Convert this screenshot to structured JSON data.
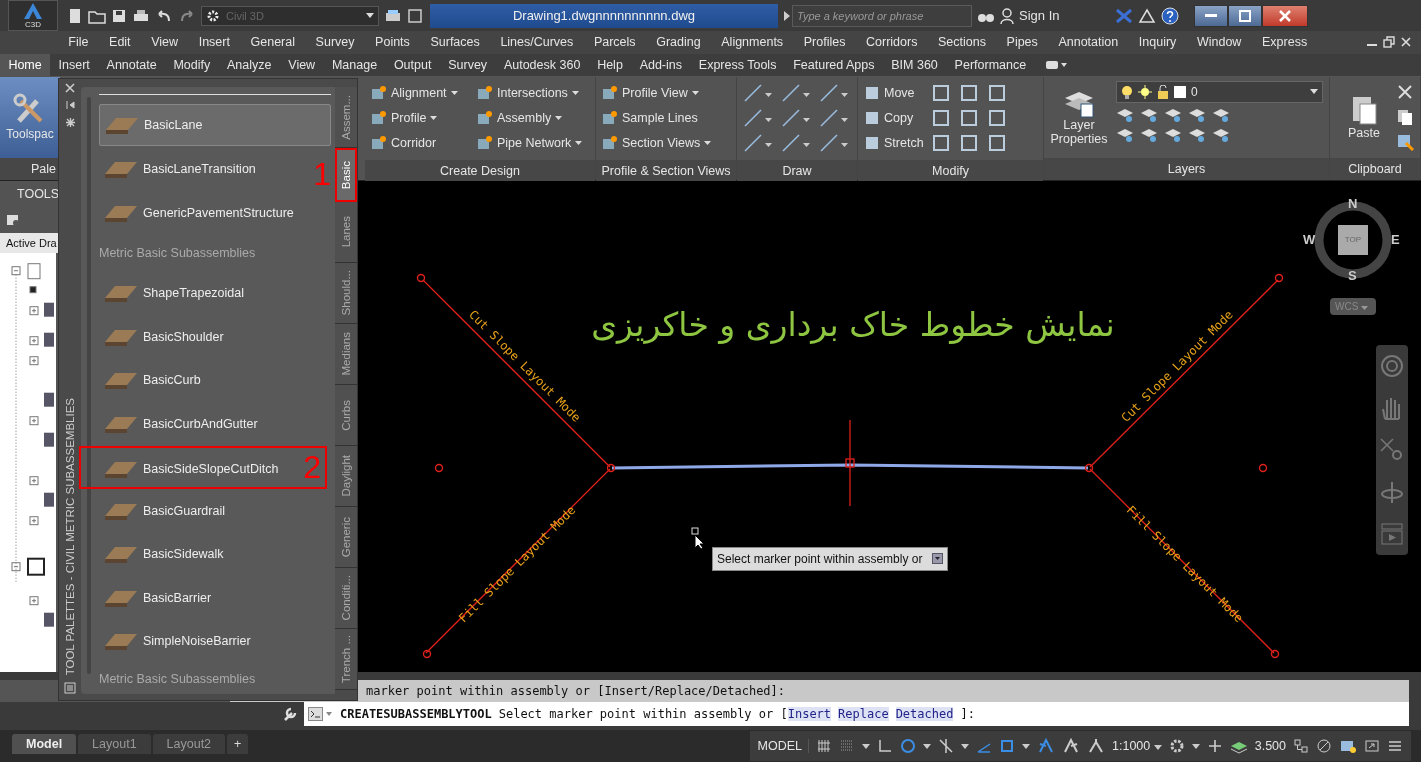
{
  "title_bar": {
    "app_badge": "C3D",
    "workspace": "Civil 3D",
    "title": "Drawing1.dwgnnnnnnnnnn.dwg",
    "search": {
      "placeholder": "Type a keyword or phrase"
    },
    "sign_in": "Sign In"
  },
  "menu_bar": [
    "File",
    "Edit",
    "View",
    "Insert",
    "General",
    "Survey",
    "Points",
    "Surfaces",
    "Lines/Curves",
    "Parcels",
    "Grading",
    "Alignments",
    "Profiles",
    "Corridors",
    "Sections",
    "Pipes",
    "Annotation",
    "Inquiry",
    "Window",
    "Express"
  ],
  "ribbon_tabs": [
    {
      "label": "Home",
      "selected": true
    },
    {
      "label": "Insert",
      "selected": false
    },
    {
      "label": "Annotate",
      "selected": false
    },
    {
      "label": "Modify",
      "selected": false
    },
    {
      "label": "Analyze",
      "selected": false
    },
    {
      "label": "View",
      "selected": false
    },
    {
      "label": "Manage",
      "selected": false
    },
    {
      "label": "Output",
      "selected": false
    },
    {
      "label": "Survey",
      "selected": false
    },
    {
      "label": "Autodesk 360",
      "selected": false
    },
    {
      "label": "Help",
      "selected": false
    },
    {
      "label": "Add-ins",
      "selected": false
    },
    {
      "label": "Express Tools",
      "selected": false
    },
    {
      "label": "Featured Apps",
      "selected": false
    },
    {
      "label": "BIM 360",
      "selected": false
    },
    {
      "label": "Performance",
      "selected": false
    }
  ],
  "ribbon": {
    "left_button": "Toolspac",
    "left_panel_title": "Pale",
    "panels": [
      {
        "kind": "tools",
        "title": "Create Design",
        "tools": [
          {
            "label": "Alignment",
            "dropdown": true
          },
          {
            "label": "Profile",
            "dropdown": true
          },
          {
            "label": "Corridor",
            "dropdown": false
          },
          {
            "label": "Intersections",
            "dropdown": true
          },
          {
            "label": "Assembly",
            "dropdown": true
          },
          {
            "label": "Pipe Network",
            "dropdown": true
          }
        ]
      },
      {
        "kind": "tools",
        "title": "Profile & Section Views",
        "tools": [
          {
            "label": "Profile View",
            "dropdown": true
          },
          {
            "label": "Sample Lines",
            "dropdown": false
          },
          {
            "label": "Section Views",
            "dropdown": true
          }
        ]
      },
      {
        "kind": "draw",
        "title": "Draw"
      },
      {
        "kind": "modify",
        "title": "Modify",
        "tools": [
          {
            "label": "Move"
          },
          {
            "label": "Copy"
          },
          {
            "label": "Stretch"
          }
        ]
      },
      {
        "kind": "layers",
        "title": "Layers",
        "button": "Layer Properties",
        "layer": "0"
      },
      {
        "kind": "clipboard",
        "title": "Clipboard",
        "button": "Paste"
      }
    ]
  },
  "toolspace": {
    "header": "TOOLS",
    "tab": "Active Dra"
  },
  "palette": {
    "title": "TOOL PALETTES - CIVIL METRIC SUBASSEMBLIES",
    "items": [
      {
        "kind": "tool",
        "label": "BasicLane",
        "selected": true
      },
      {
        "kind": "tool",
        "label": "BasicLaneTransition",
        "selected": false
      },
      {
        "kind": "tool",
        "label": "GenericPavementStructure",
        "selected": false
      },
      {
        "kind": "heading",
        "label": "Metric Basic Subassemblies"
      },
      {
        "kind": "tool",
        "label": "ShapeTrapezoidal",
        "selected": false
      },
      {
        "kind": "tool",
        "label": "BasicShoulder",
        "selected": false
      },
      {
        "kind": "tool",
        "label": "BasicCurb",
        "selected": false
      },
      {
        "kind": "tool",
        "label": "BasicCurbAndGutter",
        "selected": false
      },
      {
        "kind": "tool",
        "label": "BasicSideSlopeCutDitch",
        "selected": false,
        "callout": "2"
      },
      {
        "kind": "tool",
        "label": "BasicGuardrail",
        "selected": false
      },
      {
        "kind": "tool",
        "label": "BasicSidewalk",
        "selected": false
      },
      {
        "kind": "tool",
        "label": "BasicBarrier",
        "selected": false
      },
      {
        "kind": "tool",
        "label": "SimpleNoiseBarrier",
        "selected": false
      }
    ],
    "footer": "Metric Basic Subassemblies",
    "tabs": [
      {
        "label": "Assem...",
        "selected": false
      },
      {
        "label": "Basic",
        "selected": true,
        "callout": "1"
      },
      {
        "label": "Lanes",
        "selected": false
      },
      {
        "label": "Should...",
        "selected": false
      },
      {
        "label": "Medians",
        "selected": false
      },
      {
        "label": "Curbs",
        "selected": false
      },
      {
        "label": "Daylight",
        "selected": false
      },
      {
        "label": "Generic",
        "selected": false
      },
      {
        "label": "Conditi...",
        "selected": false
      },
      {
        "label": "Trench ...",
        "selected": false
      }
    ]
  },
  "canvas": {
    "caption": "نمایش خطوط خاک برداری و خاکریزی",
    "slope_labels": [
      {
        "text": "Cut Slope Layout Mode"
      },
      {
        "text": "Fill Slope Layout Mode"
      },
      {
        "text": "Cut Slope Layout Mode"
      },
      {
        "text": "Fill Slope Layout Mode"
      }
    ],
    "tooltip": "Select marker point within assembly or",
    "viewcube": {
      "north": "N",
      "west": "W",
      "east": "E",
      "south": "S",
      "face": "TOP",
      "ucs": "WCS"
    }
  },
  "command": {
    "history": "marker point within assembly or [Insert/Replace/Detached]:",
    "name": "CREATESUBASSEMBLYTOOL",
    "prompt": "Select marker point within assembly or [",
    "options": [
      "Insert",
      "Replace",
      "Detached"
    ],
    "end": "]:"
  },
  "layout_tabs": [
    {
      "label": "Model",
      "selected": true
    },
    {
      "label": "Layout1",
      "selected": false
    },
    {
      "label": "Layout2",
      "selected": false
    }
  ],
  "layout_add": "+",
  "status_bar": {
    "model": "MODEL",
    "scale": "1:1000",
    "lineweight": "3.500"
  }
}
